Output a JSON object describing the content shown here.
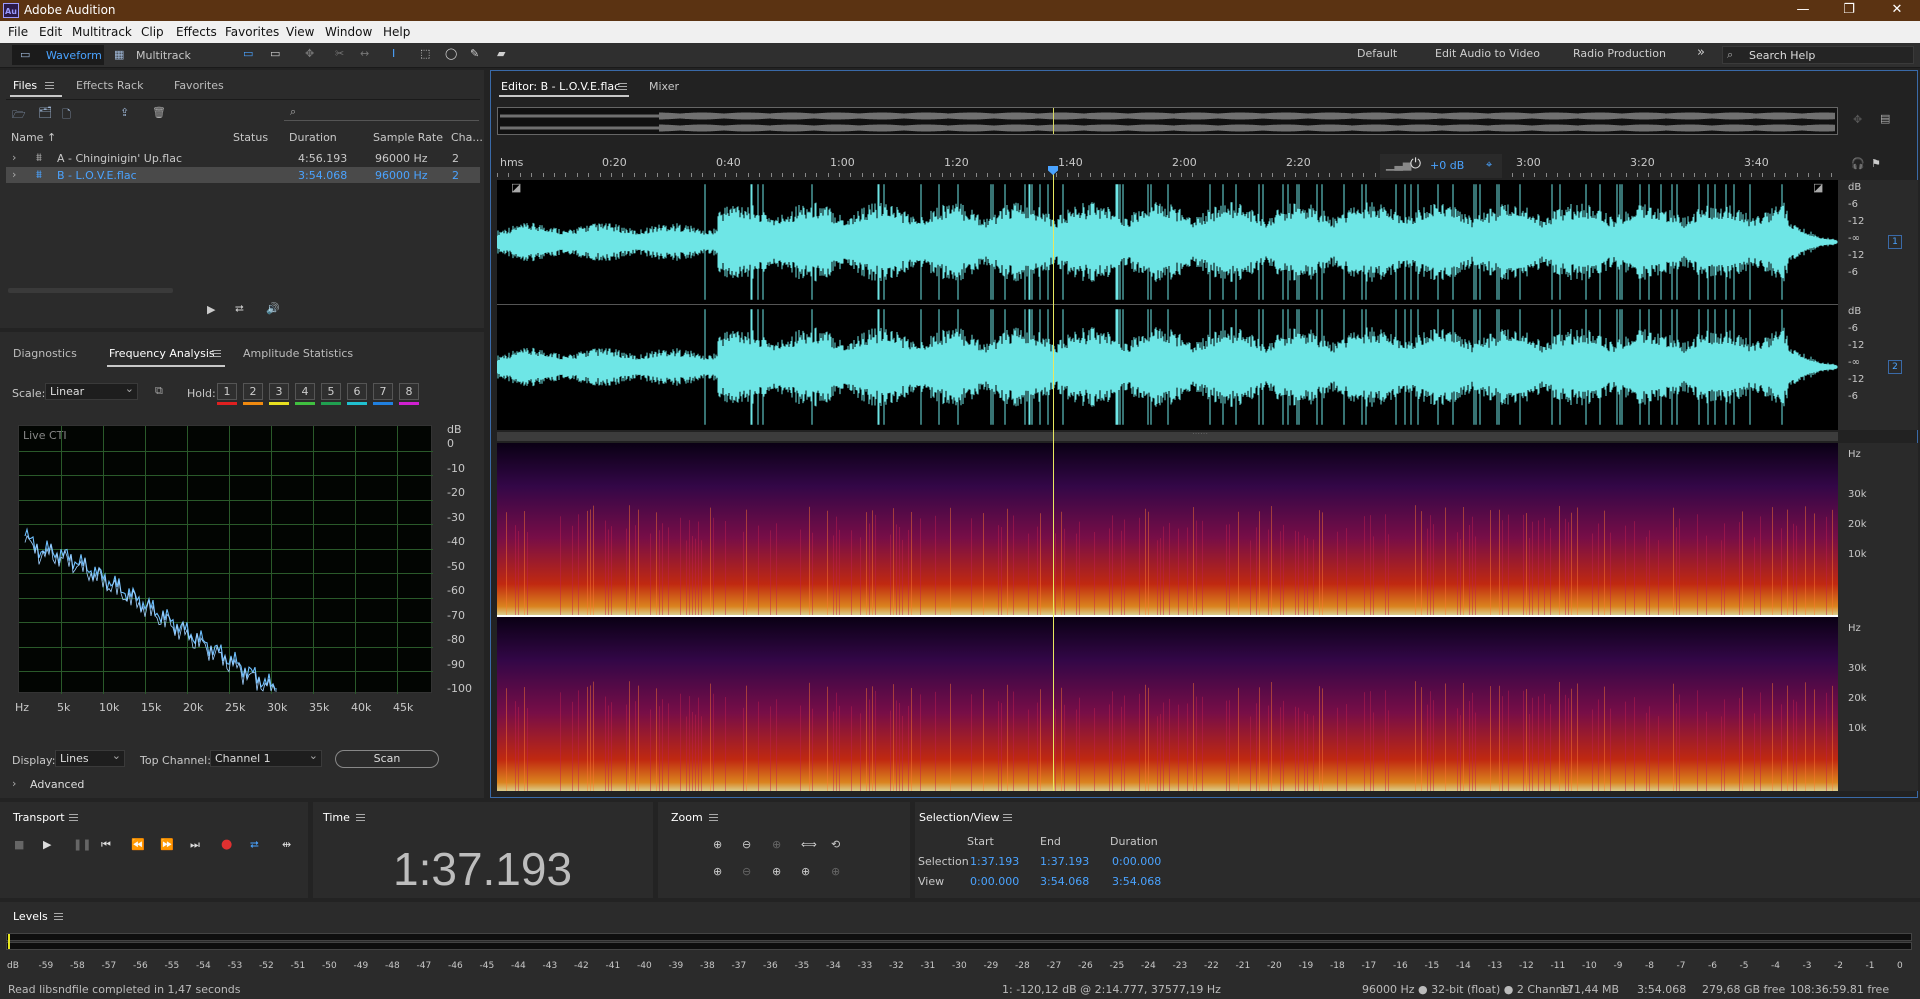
{
  "app": {
    "title": "Adobe Audition",
    "logo": "Au"
  },
  "window_controls": {
    "minimize": "—",
    "restore": "❐",
    "close": "✕"
  },
  "menu": [
    "File",
    "Edit",
    "Multitrack",
    "Clip",
    "Effects",
    "Favorites",
    "View",
    "Window",
    "Help"
  ],
  "toolbar": {
    "waveform": "Waveform",
    "multitrack": "Multitrack",
    "workspaces": [
      "Default",
      "Edit Audio to Video",
      "Radio Production"
    ],
    "more": "»",
    "search_placeholder": "Search Help"
  },
  "files_panel": {
    "tabs": [
      "Files",
      "Effects Rack",
      "Favorites"
    ],
    "columns": [
      "Name ↑",
      "Status",
      "Duration",
      "Sample Rate",
      "Cha..."
    ],
    "rows": [
      {
        "name": "A - Chinginigin' Up.flac",
        "status": "",
        "duration": "4:56.193",
        "rate": "96000 Hz",
        "channels": "2",
        "selected": false
      },
      {
        "name": "B - L.O.V.E.flac",
        "status": "",
        "duration": "3:54.068",
        "rate": "96000 Hz",
        "channels": "2",
        "selected": true
      }
    ]
  },
  "analysis_panel": {
    "tabs": [
      "Diagnostics",
      "Frequency Analysis",
      "Amplitude Statistics"
    ],
    "scale_label": "Scale:",
    "scale_value": "Linear",
    "hold_label": "Hold:",
    "hold": [
      {
        "n": "1",
        "color": "#e02020"
      },
      {
        "n": "2",
        "color": "#f08a10"
      },
      {
        "n": "3",
        "color": "#e8e020"
      },
      {
        "n": "4",
        "color": "#40c040"
      },
      {
        "n": "5",
        "color": "#20a050"
      },
      {
        "n": "6",
        "color": "#20c0d0"
      },
      {
        "n": "7",
        "color": "#2080e0"
      },
      {
        "n": "8",
        "color": "#d020d0"
      }
    ],
    "live_cti": "Live CTI",
    "db_unit": "dB",
    "db_ticks": [
      "0",
      "-10",
      "-20",
      "-30",
      "-40",
      "-50",
      "-60",
      "-70",
      "-80",
      "-90",
      "-100"
    ],
    "hz_ticks": [
      "Hz",
      "5k",
      "10k",
      "15k",
      "20k",
      "25k",
      "30k",
      "35k",
      "40k",
      "45k"
    ],
    "display_label": "Display:",
    "display_value": "Lines",
    "top_channel_label": "Top Channel:",
    "top_channel_value": "Channel 1",
    "scan": "Scan",
    "advanced": "Advanced"
  },
  "editor": {
    "tab": "Editor: B - L.O.V.E.flac",
    "mixer": "Mixer",
    "ruler": [
      "hms",
      "0:20",
      "0:40",
      "1:00",
      "1:20",
      "1:40",
      "2:00",
      "2:20",
      "3:00",
      "3:20",
      "3:40"
    ],
    "gain": "+0 dB",
    "channel1": "1",
    "channel2": "2",
    "wave_db": [
      "dB",
      "-6",
      "-12",
      "-∞",
      "-12",
      "-6"
    ],
    "spec_hz": [
      "Hz",
      "30k",
      "20k",
      "10k"
    ],
    "wave_color": "#6ee6e6"
  },
  "transport": {
    "title": "Transport"
  },
  "time": {
    "title": "Time",
    "value": "1:37.193"
  },
  "zoom": {
    "title": "Zoom"
  },
  "selection_view": {
    "title": "Selection/View",
    "headers": [
      "Start",
      "End",
      "Duration"
    ],
    "selection_label": "Selection",
    "selection": [
      "1:37.193",
      "1:37.193",
      "0:00.000"
    ],
    "view_label": "View",
    "view": [
      "0:00.000",
      "3:54.068",
      "3:54.068"
    ]
  },
  "levels": {
    "title": "Levels",
    "scale": [
      "dB",
      "-59",
      "-58",
      "-57",
      "-56",
      "-55",
      "-54",
      "-53",
      "-52",
      "-51",
      "-50",
      "-49",
      "-48",
      "-47",
      "-46",
      "-45",
      "-44",
      "-43",
      "-42",
      "-41",
      "-40",
      "-39",
      "-38",
      "-37",
      "-36",
      "-35",
      "-34",
      "-33",
      "-32",
      "-31",
      "-30",
      "-29",
      "-28",
      "-27",
      "-26",
      "-25",
      "-24",
      "-23",
      "-22",
      "-21",
      "-20",
      "-19",
      "-18",
      "-17",
      "-16",
      "-15",
      "-14",
      "-13",
      "-12",
      "-11",
      "-10",
      "-9",
      "-8",
      "-7",
      "-6",
      "-5",
      "-4",
      "-3",
      "-2",
      "-1",
      "0"
    ]
  },
  "status": {
    "left": "Read libsndfile completed in 1,47 seconds",
    "cursor": "1: -120,12 dB @ 2:14.777, 37577,19 Hz",
    "format": "96000 Hz ● 32-bit (float) ● 2 Channel",
    "size": "171,44 MB",
    "duration": "3:54.068",
    "free": "279,68 GB free",
    "free_time": "108:36:59.81 free"
  }
}
